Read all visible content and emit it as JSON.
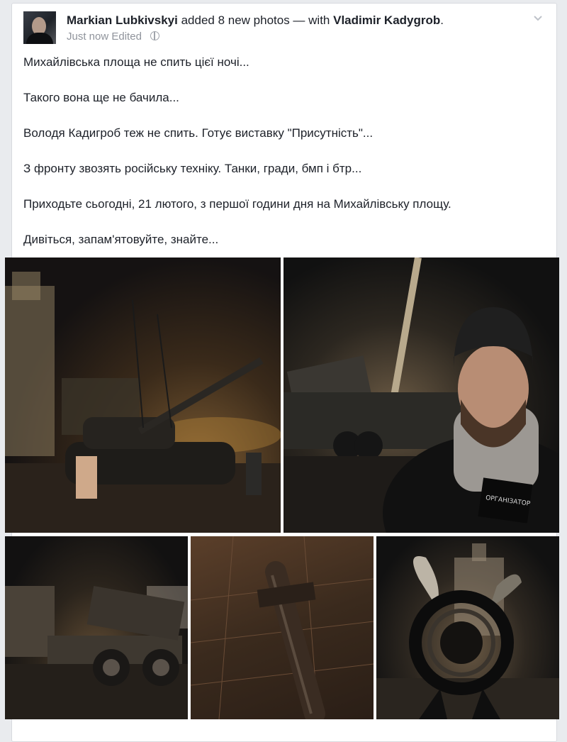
{
  "post": {
    "author": "Markian Lubkivskyi",
    "action": "added 8 new photos — with",
    "tagged": "Vladimir Kadygrob",
    "suffix": ".",
    "time": "Just now",
    "edited": "Edited",
    "privacy_icon": "globe-icon",
    "menu_icon": "chevron-down-icon",
    "lines": [
      "Михайлівська площа не спить цієї ночі...",
      "Такого вона ще не бачила...",
      "Володя Кадигроб теж не спить. Готує виставку \"Присутність\"...",
      "З фронту звозять російську техніку. Танки, гради, бмп і бтр...",
      "Приходьте сьогодні, 21 лютого, з першої години дня на Михайлівську площу.",
      "Дивіться, запам'ятовуйте, знайте..."
    ]
  },
  "photos": {
    "badge_text": "ОРГАНІЗАТОР"
  }
}
